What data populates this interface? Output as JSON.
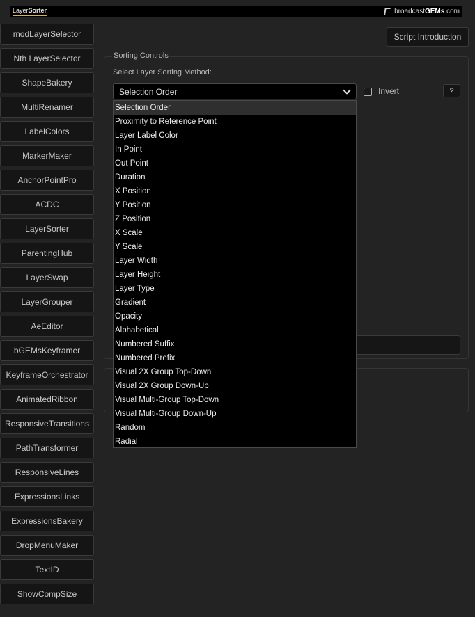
{
  "banner": {
    "left_logo_light": "Layer",
    "left_logo_bold": "Sorter",
    "right_brand_light": "broadcast",
    "right_brand_bold": "GEMs",
    "right_brand_suffix": ".com"
  },
  "sidebar": {
    "items": [
      "modLayerSelector",
      "Nth LayerSelector",
      "ShapeBakery",
      "MultiRenamer",
      "LabelColors",
      "MarkerMaker",
      "AnchorPointPro",
      "ACDC",
      "LayerSorter",
      "ParentingHub",
      "LayerSwap",
      "LayerGrouper",
      "AeEditor",
      "bGEMsKeyframer",
      "KeyframeOrchestrator",
      "AnimatedRibbon",
      "ResponsiveTransitions",
      "PathTransformer",
      "ResponsiveLines",
      "ExpressionsLinks",
      "ExpressionsBakery",
      "DropMenuMaker",
      "TextID",
      "ShowCompSize"
    ]
  },
  "header": {
    "intro_button": "Script Introduction"
  },
  "sorting": {
    "panel_title": "Sorting Controls",
    "method_label": "Select Layer Sorting Method:",
    "selected_value": "Selection Order",
    "invert_label": "Invert",
    "invert_checked": false,
    "help_label": "?",
    "options": [
      "Selection Order",
      "Proximity to Reference Point",
      "Layer Label Color",
      "In Point",
      "Out Point",
      "Duration",
      "X Position",
      "Y Position",
      "Z Position",
      "X Scale",
      "Y Scale",
      "Layer Width",
      "Layer Height",
      "Layer Type",
      "Gradient",
      "Opacity",
      "Alphabetical",
      "Numbered Suffix",
      "Numbered Prefix",
      "Visual 2X Group Top-Down",
      "Visual 2X Group Down-Up",
      "Visual Multi-Group Top-Down",
      "Visual Multi-Group Down-Up",
      "Random",
      "Radial"
    ]
  },
  "colors": {
    "background": "#232323",
    "banner": "#000000",
    "accent": "#d9b44a",
    "button_bg": "#151515",
    "dropdown_bg": "#000000",
    "selected_option_bg": "#2f2f2f"
  }
}
